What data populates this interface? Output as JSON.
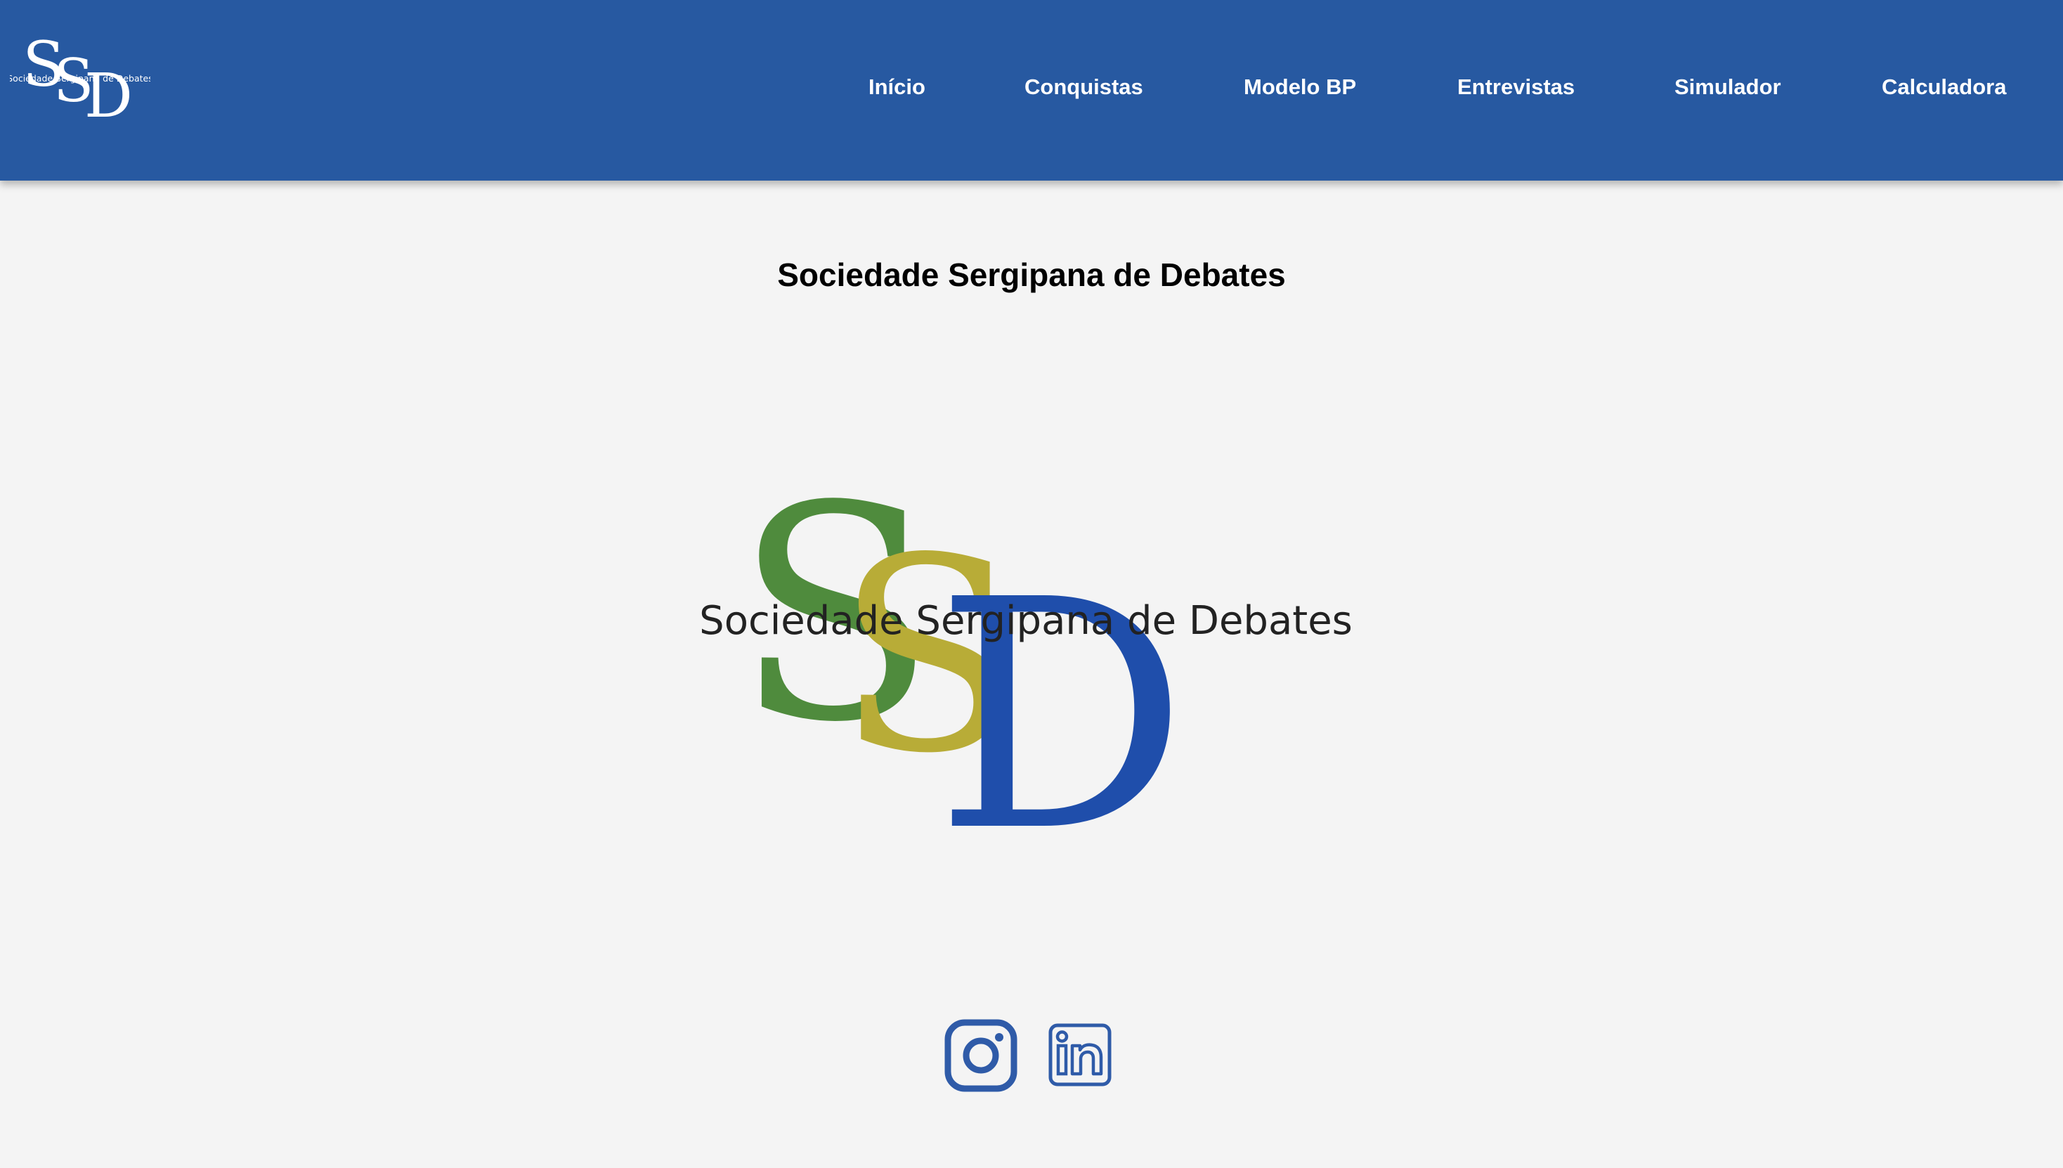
{
  "header": {
    "logo": {
      "monogram": "SSD",
      "caption": "Sociedade Sergipana de Debates"
    },
    "nav": [
      {
        "label": "Início"
      },
      {
        "label": "Conquistas"
      },
      {
        "label": "Modelo BP"
      },
      {
        "label": "Entrevistas"
      },
      {
        "label": "Simulador"
      },
      {
        "label": "Calculadora"
      }
    ]
  },
  "main": {
    "title": "Sociedade Sergipana de Debates",
    "logo": {
      "letters": [
        "S",
        "S",
        "D"
      ],
      "caption": "Sociedade Sergipana de Debates",
      "colors": {
        "first_s": "#4f8b3d",
        "second_s": "#b8ac37",
        "d": "#1f4eab"
      }
    }
  },
  "footer": {
    "social": [
      {
        "icon": "instagram-icon",
        "color": "#2f5ba8"
      },
      {
        "icon": "linkedin-icon",
        "color": "#2f5ba8"
      }
    ]
  },
  "colors": {
    "header_bg": "#2759a1",
    "page_bg": "#f4f4f4",
    "nav_text": "#ffffff"
  }
}
